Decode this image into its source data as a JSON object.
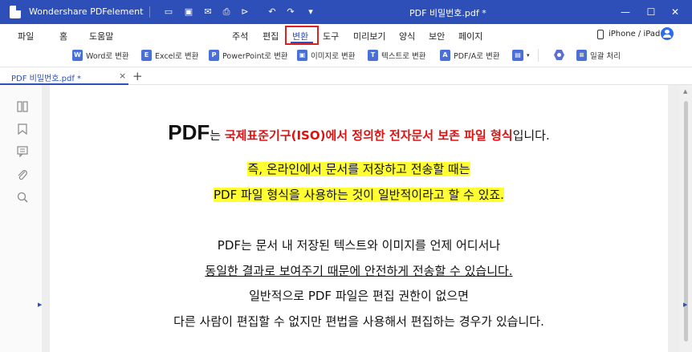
{
  "titlebar": {
    "app_name": "Wondershare PDFelement",
    "doc_title": "PDF 비밀번호.pdf *",
    "bg_color": "#2d4fb7"
  },
  "menubar": {
    "left_items": [
      "파일",
      "홈",
      "도움말"
    ],
    "center_items": [
      "주석",
      "편집",
      "변환",
      "도구",
      "미리보기",
      "양식",
      "보안",
      "페이지"
    ],
    "active_item": "변환",
    "device_label": "iPhone / iPad"
  },
  "toolbar": {
    "items": [
      {
        "label": "Word로 변환",
        "icon": "word-icon",
        "color": "#4a6fd8",
        "glyph": "W"
      },
      {
        "label": "Excel로 변환",
        "icon": "excel-icon",
        "color": "#4a6fd8",
        "glyph": "E"
      },
      {
        "label": "PowerPoint로 변환",
        "icon": "powerpoint-icon",
        "color": "#4a6fd8",
        "glyph": "P"
      },
      {
        "label": "이미지로 변환",
        "icon": "image-icon",
        "color": "#4a6fd8",
        "glyph": "▣"
      },
      {
        "label": "텍스트로 변환",
        "icon": "text-icon",
        "color": "#4a6fd8",
        "glyph": "T"
      },
      {
        "label": "PDF/A로 변환",
        "icon": "pdfa-icon",
        "color": "#4a6fd8",
        "glyph": "A"
      }
    ],
    "batch_label": "일괄 처리"
  },
  "tabs": {
    "doc_tab": "PDF 비밀번호.pdf *"
  },
  "document": {
    "line1_pdf": "PDF",
    "line1_a": "는 ",
    "line1_red": "국제표준기구(ISO)에서 정의한 전자문서 보존 파일 형식",
    "line1_b": "입니다.",
    "line2": "즉, 온라인에서 문서를 저장하고 전송할 때는",
    "line3": "PDF 파일 형식을 사용하는 것이 일반적이라고 할 수 있죠.",
    "line4": "PDF는 문서 내 저장된 텍스트와 이미지를 언제 어디서나",
    "line5": "동일한 결과로 보여주기 때문에 안전하게 전송할 수 있습니다.",
    "line6": "일반적으로 PDF 파일은 편집 권한이 없으면",
    "line7": "다른 사람이 편집할 수 없지만 편법을 사용해서 편집하는 경우가 있습니다."
  }
}
